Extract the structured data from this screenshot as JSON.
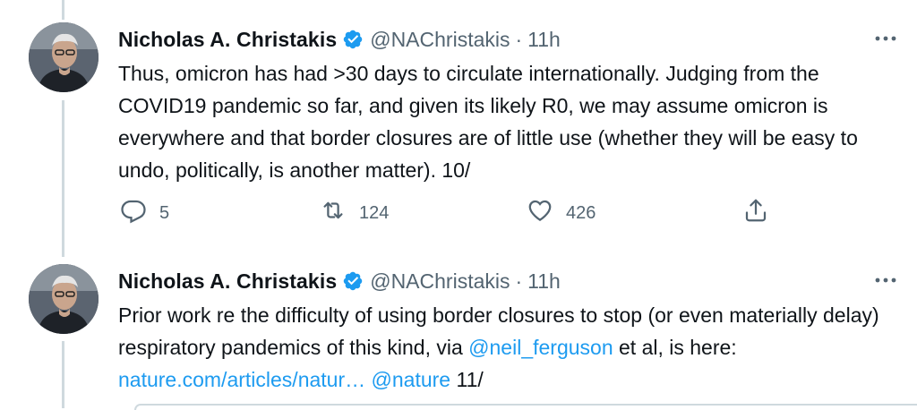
{
  "tweets": [
    {
      "author_name": "Nicholas A. Christakis",
      "handle": "@NAChristakis",
      "separator": "·",
      "time": "11h",
      "text": "Thus, omicron has had >30 days to circulate internationally. Judging from the COVID19 pandemic so far, and given its likely R0, we may assume omicron is everywhere and that border closures are of little use (whether they will be easy to undo, politically, is another matter). 10/",
      "replies": "5",
      "retweets": "124",
      "likes": "426"
    },
    {
      "author_name": "Nicholas A. Christakis",
      "handle": "@NAChristakis",
      "separator": "·",
      "time": "11h",
      "text_part1": "Prior work re the difficulty of using border closures to stop (or even materially delay) respiratory pandemics of this kind, via ",
      "mention1": "@neil_ferguson",
      "text_part2": " et al, is here: ",
      "link": "nature.com/articles/natur…",
      "text_part3": " ",
      "mention2": "@nature",
      "text_part4": " 11/"
    }
  ],
  "icons": {
    "verified": "verified-badge-icon",
    "more": "more-options-icon",
    "reply": "reply-icon",
    "retweet": "retweet-icon",
    "like": "heart-icon",
    "share": "share-icon"
  },
  "colors": {
    "accent": "#1d9bf0",
    "secondary_text": "#536471",
    "thread_line": "#cfd9de"
  }
}
